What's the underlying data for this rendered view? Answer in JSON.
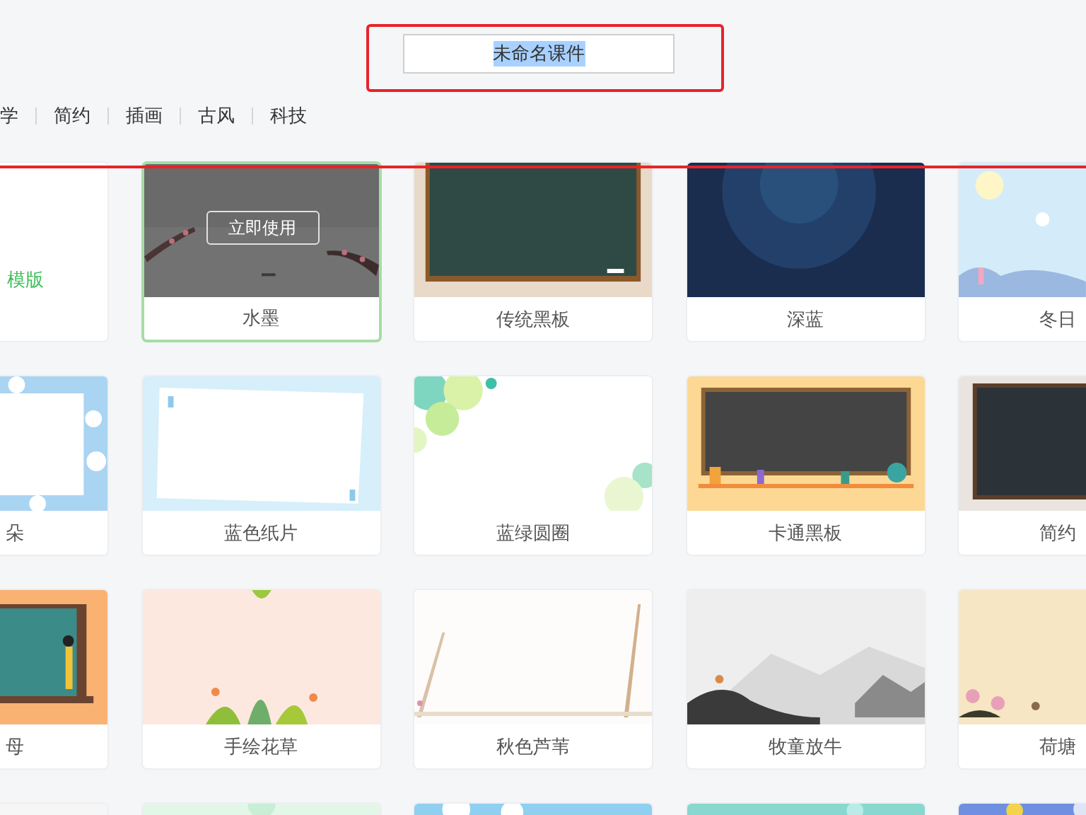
{
  "title_field": {
    "value": "未命名课件",
    "text_selected": true
  },
  "categories": [
    "学",
    "简约",
    "插画",
    "古风",
    "科技"
  ],
  "template_rows": [
    [
      {
        "kind": "blank",
        "label": "模版",
        "selected": false
      },
      {
        "kind": "template",
        "label": "水墨",
        "selected": true,
        "action": "立即使用"
      },
      {
        "kind": "template",
        "label": "传统黑板",
        "selected": false
      },
      {
        "kind": "template",
        "label": "深蓝",
        "selected": false
      },
      {
        "kind": "template",
        "label": "冬日",
        "selected": false
      }
    ],
    [
      {
        "kind": "template",
        "label": "朵",
        "selected": false
      },
      {
        "kind": "template",
        "label": "蓝色纸片",
        "selected": false
      },
      {
        "kind": "template",
        "label": "蓝绿圆圈",
        "selected": false
      },
      {
        "kind": "template",
        "label": "卡通黑板",
        "selected": false
      },
      {
        "kind": "template",
        "label": "简约",
        "selected": false
      }
    ],
    [
      {
        "kind": "template",
        "label": "母",
        "selected": false
      },
      {
        "kind": "template",
        "label": "手绘花草",
        "selected": false
      },
      {
        "kind": "template",
        "label": "秋色芦苇",
        "selected": false
      },
      {
        "kind": "template",
        "label": "牧童放牛",
        "selected": false
      },
      {
        "kind": "template",
        "label": "荷塘",
        "selected": false
      }
    ],
    [
      {
        "kind": "template",
        "selected": false
      },
      {
        "kind": "template",
        "selected": false
      },
      {
        "kind": "template",
        "selected": false
      },
      {
        "kind": "template",
        "selected": false
      },
      {
        "kind": "template",
        "selected": false
      }
    ]
  ],
  "annotations": {
    "box_around_title": true,
    "line_across": true
  }
}
